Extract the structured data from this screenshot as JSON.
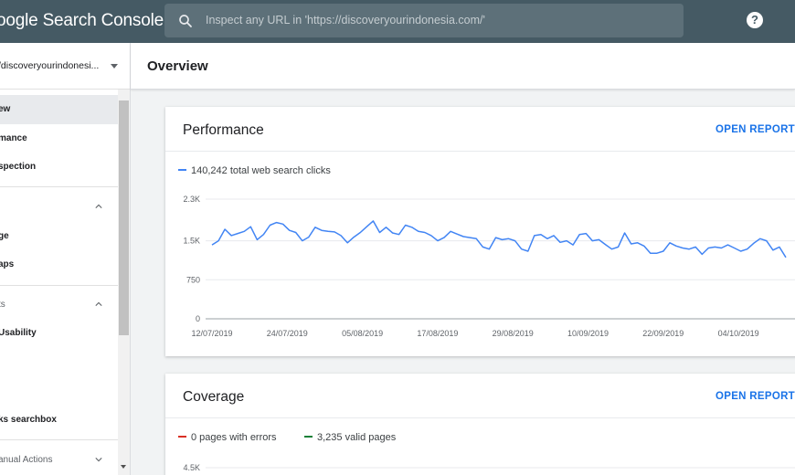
{
  "header": {
    "logo_text": "oogle Search Console",
    "search_placeholder": "Inspect any URL in 'https://discoveryourindonesia.com/'",
    "help_label": "?"
  },
  "sidebar": {
    "property": "/discoveryourindonesi...",
    "items": [
      {
        "label": "ew",
        "selected": true
      },
      {
        "label": "mance"
      },
      {
        "label": "spection"
      }
    ],
    "section1": {
      "label": ""
    },
    "section1_items": [
      {
        "label": "ge"
      },
      {
        "label": "aps"
      }
    ],
    "section2": {
      "label": "ts"
    },
    "section2_items": [
      {
        "label": "Usability"
      },
      {
        "label": "ks searchbox"
      }
    ],
    "section3": {
      "label": "anual Actions"
    }
  },
  "main": {
    "title": "Overview"
  },
  "performance": {
    "title": "Performance",
    "link": "OPEN REPORT",
    "legend": "140,242 total web search clicks",
    "color": "#4285f4"
  },
  "coverage": {
    "title": "Coverage",
    "link": "OPEN REPORT",
    "legend_errors": "0 pages with errors",
    "legend_valid": "3,235 valid pages",
    "error_color": "#d93025",
    "valid_color": "#188038",
    "first_tick": "4.5K"
  },
  "chart_data": {
    "type": "line",
    "title": "",
    "xlabel": "",
    "ylabel": "",
    "ylim": [
      0,
      2300
    ],
    "y_ticks": [
      "0",
      "750",
      "1.5K",
      "2.3K"
    ],
    "y_tick_values": [
      0,
      750,
      1500,
      2300
    ],
    "x_ticks": [
      "12/07/2019",
      "24/07/2019",
      "05/08/2019",
      "17/08/2019",
      "29/08/2019",
      "10/09/2019",
      "22/09/2019",
      "04/10/2019"
    ],
    "grid": true,
    "series": [
      {
        "name": "",
        "values": [
          1420,
          1500,
          1720,
          1600,
          1640,
          1680,
          1770,
          1520,
          1620,
          1800,
          1850,
          1820,
          1700,
          1660,
          1500,
          1570,
          1760,
          1700,
          1680,
          1670,
          1600,
          1460,
          1570,
          1660,
          1770,
          1880,
          1660,
          1760,
          1650,
          1620,
          1800,
          1760,
          1680,
          1660,
          1600,
          1500,
          1560,
          1680,
          1630,
          1580,
          1560,
          1540,
          1380,
          1340,
          1560,
          1520,
          1540,
          1500,
          1340,
          1300,
          1600,
          1620,
          1540,
          1600,
          1470,
          1500,
          1420,
          1620,
          1640,
          1500,
          1520,
          1430,
          1340,
          1380,
          1650,
          1440,
          1460,
          1400,
          1260,
          1260,
          1300,
          1460,
          1400,
          1360,
          1340,
          1380,
          1240,
          1360,
          1380,
          1360,
          1420,
          1360,
          1300,
          1340,
          1450,
          1540,
          1500,
          1320,
          1380,
          1180
        ]
      }
    ]
  }
}
